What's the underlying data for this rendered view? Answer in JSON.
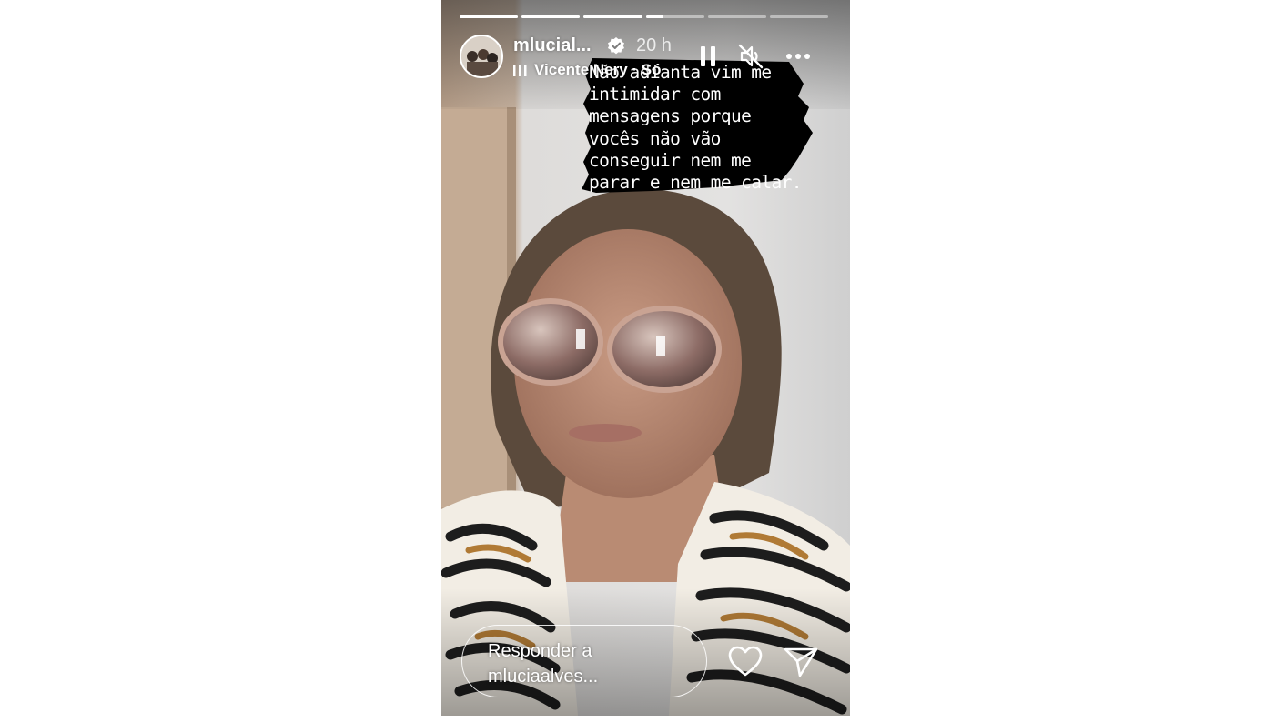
{
  "story": {
    "progress": [
      1,
      1,
      1,
      0.3,
      0,
      0
    ],
    "user": {
      "username": "mlucial...",
      "verified_icon": "verified-badge-icon",
      "time": "20 h"
    },
    "music": {
      "icon": "music-bars-icon",
      "text": "Vicente Nery · Só"
    },
    "controls": {
      "pause_icon": "pause-icon",
      "mute_icon": "muted-speaker-icon",
      "more_icon": "more-options-icon"
    },
    "sticker_text": "Não adianta vim me\nintimidar com\nmensagens porque\nvocês não vão\nconseguir nem me\nparar e nem me calar.",
    "reply": {
      "placeholder": "Responder a mluciaalves...",
      "like_icon": "heart-icon",
      "share_icon": "send-icon"
    },
    "colors": {
      "accent": "#ffffff",
      "sticker_bg": "#000000"
    }
  }
}
